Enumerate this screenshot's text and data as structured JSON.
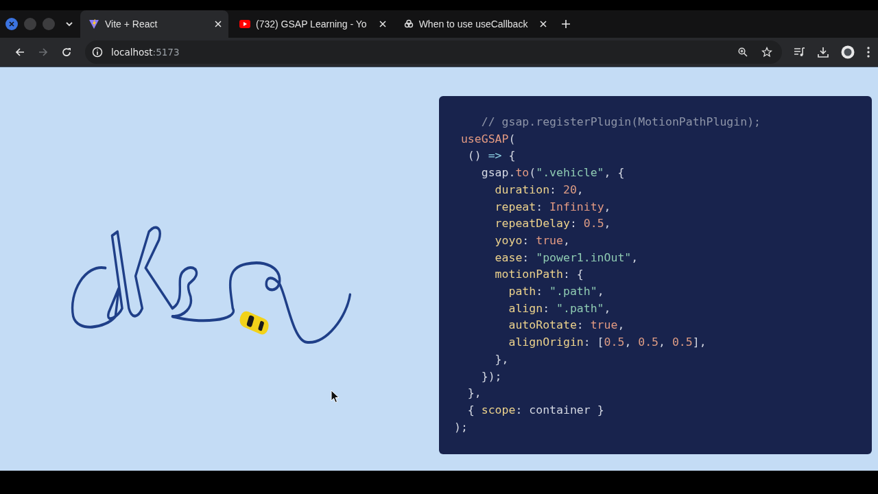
{
  "tabs": [
    {
      "title": "Vite + React",
      "selected": true
    },
    {
      "title": "(732) GSAP Learning - Yo",
      "selected": false
    },
    {
      "title": "When to use useCallback",
      "selected": false
    }
  ],
  "toolbar": {
    "forward_disabled": true
  },
  "address_bar": {
    "host": "localhost",
    "port": ":5173"
  },
  "code": {
    "lines": [
      [
        {
          "kind": "comment",
          "text": "    // gsap.registerPlugin(MotionPathPlugin);"
        }
      ],
      [
        {
          "kind": "fn",
          "text": " useGSAP"
        },
        {
          "kind": "punct",
          "text": "("
        }
      ],
      [
        {
          "kind": "punct",
          "text": "  () "
        },
        {
          "kind": "op",
          "text": "=>"
        },
        {
          "kind": "punct",
          "text": " {"
        }
      ],
      [
        {
          "kind": "plain",
          "text": "    gsap."
        },
        {
          "kind": "fn",
          "text": "to"
        },
        {
          "kind": "punct",
          "text": "("
        },
        {
          "kind": "string",
          "text": "\".vehicle\""
        },
        {
          "kind": "punct",
          "text": ", {"
        }
      ],
      [
        {
          "kind": "prop",
          "text": "      duration"
        },
        {
          "kind": "punct",
          "text": ": "
        },
        {
          "kind": "number",
          "text": "20"
        },
        {
          "kind": "punct",
          "text": ","
        }
      ],
      [
        {
          "kind": "prop",
          "text": "      repeat"
        },
        {
          "kind": "punct",
          "text": ": "
        },
        {
          "kind": "keyword",
          "text": "Infinity"
        },
        {
          "kind": "punct",
          "text": ","
        }
      ],
      [
        {
          "kind": "prop",
          "text": "      repeatDelay"
        },
        {
          "kind": "punct",
          "text": ": "
        },
        {
          "kind": "number",
          "text": "0.5"
        },
        {
          "kind": "punct",
          "text": ","
        }
      ],
      [
        {
          "kind": "prop",
          "text": "      yoyo"
        },
        {
          "kind": "punct",
          "text": ": "
        },
        {
          "kind": "keyword",
          "text": "true"
        },
        {
          "kind": "punct",
          "text": ","
        }
      ],
      [
        {
          "kind": "prop",
          "text": "      ease"
        },
        {
          "kind": "punct",
          "text": ": "
        },
        {
          "kind": "string",
          "text": "\"power1.inOut\""
        },
        {
          "kind": "punct",
          "text": ","
        }
      ],
      [
        {
          "kind": "prop",
          "text": "      motionPath"
        },
        {
          "kind": "punct",
          "text": ": {"
        }
      ],
      [
        {
          "kind": "prop",
          "text": "        path"
        },
        {
          "kind": "punct",
          "text": ": "
        },
        {
          "kind": "string",
          "text": "\".path\""
        },
        {
          "kind": "punct",
          "text": ","
        }
      ],
      [
        {
          "kind": "prop",
          "text": "        align"
        },
        {
          "kind": "punct",
          "text": ": "
        },
        {
          "kind": "string",
          "text": "\".path\""
        },
        {
          "kind": "punct",
          "text": ","
        }
      ],
      [
        {
          "kind": "prop",
          "text": "        autoRotate"
        },
        {
          "kind": "punct",
          "text": ": "
        },
        {
          "kind": "keyword",
          "text": "true"
        },
        {
          "kind": "punct",
          "text": ","
        }
      ],
      [
        {
          "kind": "prop",
          "text": "        alignOrigin"
        },
        {
          "kind": "punct",
          "text": ": ["
        },
        {
          "kind": "number",
          "text": "0.5"
        },
        {
          "kind": "punct",
          "text": ", "
        },
        {
          "kind": "number",
          "text": "0.5"
        },
        {
          "kind": "punct",
          "text": ", "
        },
        {
          "kind": "number",
          "text": "0.5"
        },
        {
          "kind": "punct",
          "text": "],"
        }
      ],
      [
        {
          "kind": "punct",
          "text": "      },"
        }
      ],
      [
        {
          "kind": "punct",
          "text": "    });"
        }
      ],
      [
        {
          "kind": "punct",
          "text": "  },"
        }
      ],
      [
        {
          "kind": "punct",
          "text": "  { "
        },
        {
          "kind": "prop",
          "text": "scope"
        },
        {
          "kind": "punct",
          "text": ": "
        },
        {
          "kind": "plain",
          "text": "container"
        },
        {
          "kind": "punct",
          "text": " }"
        }
      ],
      [
        {
          "kind": "punct",
          "text": ");"
        }
      ]
    ]
  }
}
